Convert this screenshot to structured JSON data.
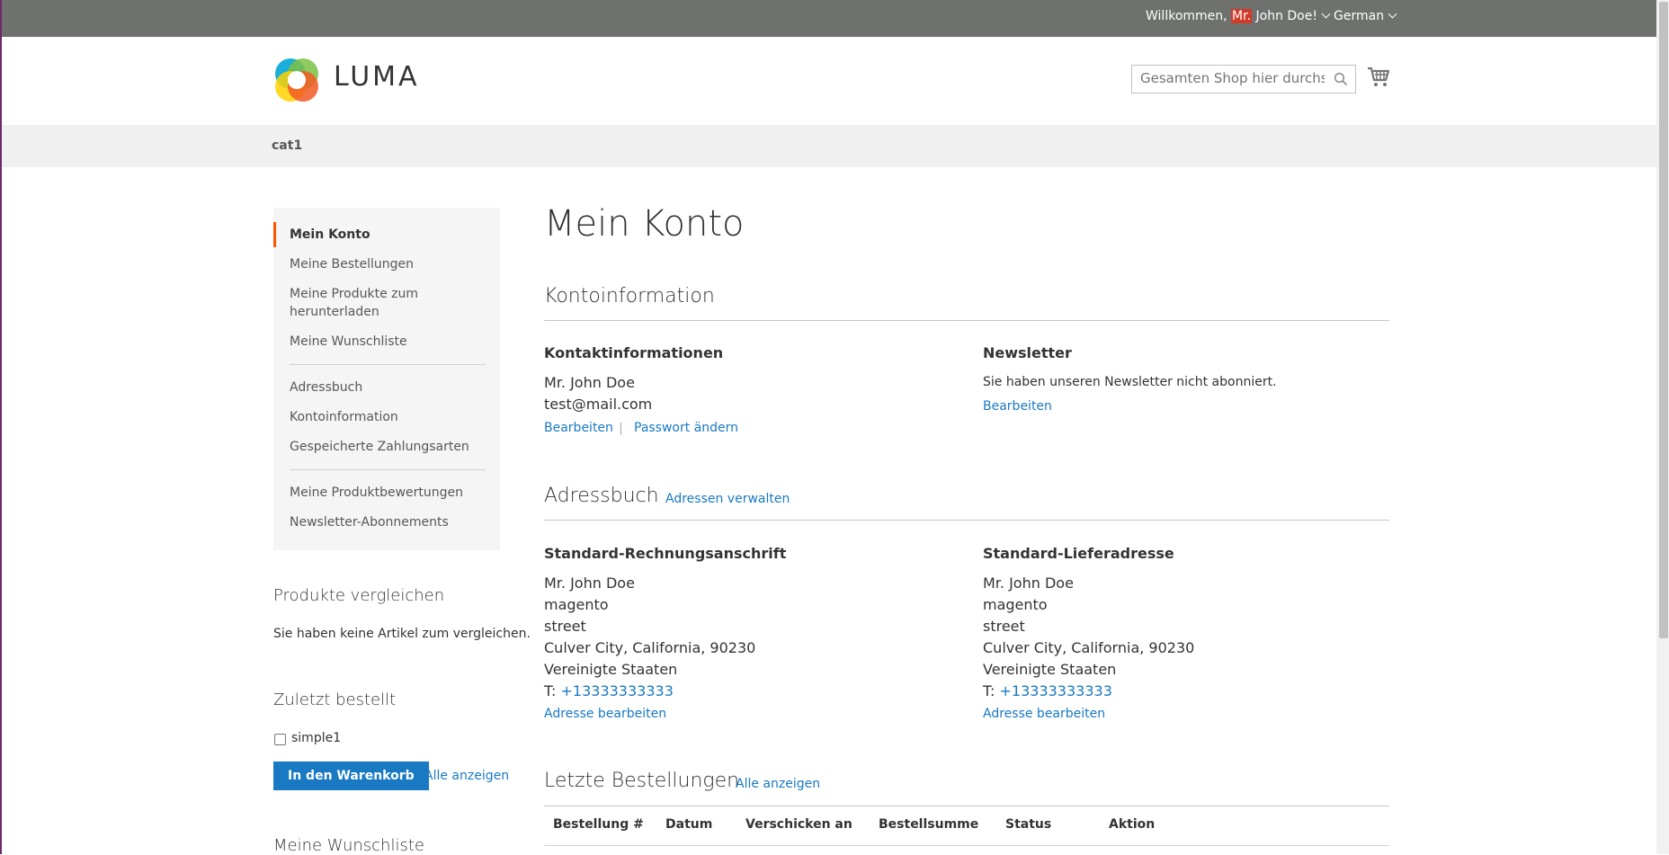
{
  "topbar": {
    "greet_prefix": "Willkommen, ",
    "greet_highlight": "Mr.",
    "greet_suffix": " John Doe!",
    "language": "German"
  },
  "header": {
    "logo_text": "LUMA",
    "search_placeholder": "Gesamten Shop hier durchsuchen..."
  },
  "nav": {
    "items": [
      "cat1"
    ]
  },
  "sidebar": {
    "items": [
      "Mein Konto",
      "Meine Bestellungen",
      "Meine Produkte zum herunterladen",
      "Meine Wunschliste",
      "Adressbuch",
      "Kontoinformation",
      "Gespeicherte Zahlungsarten",
      "Meine Produktbewertungen",
      "Newsletter-Abonnements"
    ],
    "active_index": 0
  },
  "compare": {
    "title": "Produkte vergleichen",
    "text": "Sie haben keine Artikel zum vergleichen."
  },
  "reorder": {
    "title": "Zuletzt bestellt",
    "item": "simple1",
    "add_button": "In den Warenkorb",
    "view_all": "Alle anzeigen"
  },
  "wishlist": {
    "title": "Meine Wunschliste"
  },
  "main": {
    "page_title": "Mein Konto",
    "account_info": {
      "title": "Kontoinformation",
      "contact": {
        "title": "Kontaktinformationen",
        "name": "Mr. John Doe",
        "email": "test@mail.com",
        "edit": "Bearbeiten",
        "change_password": "Passwort ändern"
      },
      "newsletter": {
        "title": "Newsletter",
        "text": "Sie haben unseren Newsletter nicht abonniert.",
        "edit": "Bearbeiten"
      }
    },
    "address_book": {
      "title": "Adressbuch",
      "manage": "Adressen verwalten",
      "billing": {
        "title": "Standard-Rechnungsanschrift",
        "lines": [
          "Mr. John Doe",
          "magento",
          "street",
          "Culver City, California, 90230",
          "Vereinigte Staaten"
        ],
        "phone_prefix": "T: ",
        "phone": "+13333333333",
        "edit": "Adresse bearbeiten"
      },
      "shipping": {
        "title": "Standard-Lieferadresse",
        "lines": [
          "Mr. John Doe",
          "magento",
          "street",
          "Culver City, California, 90230",
          "Vereinigte Staaten"
        ],
        "phone_prefix": "T: ",
        "phone": "+13333333333",
        "edit": "Adresse bearbeiten"
      }
    },
    "orders": {
      "title": "Letzte Bestellungen",
      "view_all": "Alle anzeigen",
      "columns": [
        "Bestellung #",
        "Datum",
        "Verschicken an",
        "Bestellsumme",
        "Status",
        "Aktion"
      ]
    }
  },
  "colors": {
    "topbar": "#6e716e",
    "link": "#1979c3",
    "active_marker": "#ff5501",
    "highlight": "#d23b2a"
  }
}
